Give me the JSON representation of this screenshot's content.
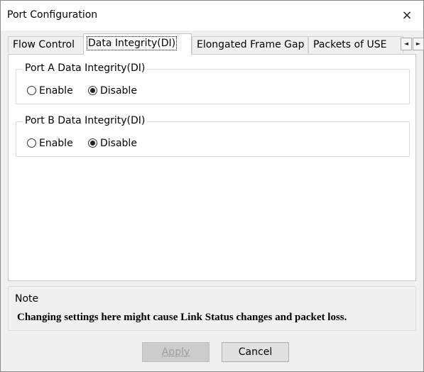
{
  "window": {
    "title": "Port Configuration",
    "close_glyph": "×"
  },
  "tabs": [
    {
      "label": "Flow Control"
    },
    {
      "label": "Data Integrity(DI)",
      "active": true
    },
    {
      "label": "Elongated Frame Gap"
    },
    {
      "label": "Packets of USE"
    }
  ],
  "tab_scroll": {
    "left_glyph": "◄",
    "right_glyph": "►"
  },
  "groups": [
    {
      "label": "Port A Data Integrity(DI)",
      "options": [
        "Enable",
        "Disable"
      ],
      "selected": "Disable"
    },
    {
      "label": "Port B Data Integrity(DI)",
      "options": [
        "Enable",
        "Disable"
      ],
      "selected": "Disable"
    }
  ],
  "note": {
    "label": "Note",
    "text": "Changing settings here might cause Link Status changes and packet loss."
  },
  "buttons": {
    "apply": {
      "label": "Apply",
      "enabled": false
    },
    "cancel": {
      "label": "Cancel",
      "enabled": true
    }
  }
}
